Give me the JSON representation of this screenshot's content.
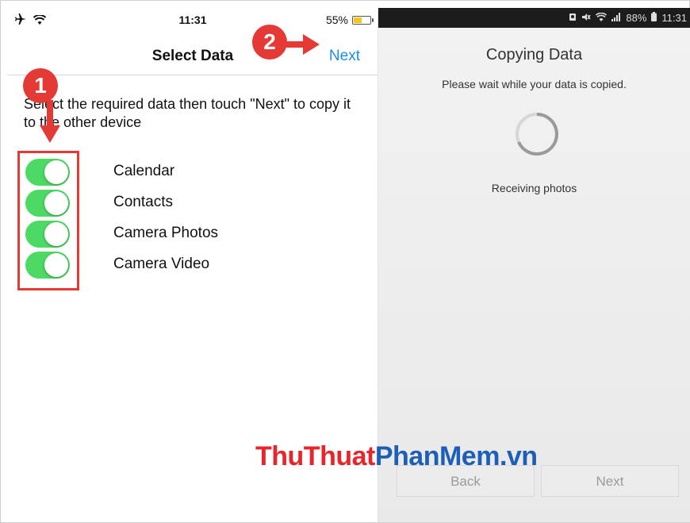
{
  "ios": {
    "status": {
      "time": "11:31",
      "battery_percent": "55%",
      "battery_level": 0.55
    },
    "nav": {
      "title": "Select Data",
      "next_label": "Next"
    },
    "instructions": "Select the required data then touch \"Next\" to copy it to the other device",
    "options": [
      {
        "label": "Calendar",
        "on": true
      },
      {
        "label": "Contacts",
        "on": true
      },
      {
        "label": "Camera Photos",
        "on": true
      },
      {
        "label": "Camera Video",
        "on": true
      }
    ],
    "annotations": {
      "step1": "1",
      "step2": "2"
    },
    "colors": {
      "toggle_on": "#4cd964",
      "link": "#1a8cf0",
      "annotation": "#e53935"
    }
  },
  "android": {
    "status": {
      "battery": "88%",
      "time": "11:31"
    },
    "title": "Copying Data",
    "subtitle": "Please wait while your data is copied.",
    "progress_text": "Receiving photos",
    "buttons": {
      "back": "Back",
      "next": "Next"
    }
  },
  "watermark": {
    "part1": "ThuThuat",
    "part2": "PhanMem",
    "part3": ".vn"
  }
}
